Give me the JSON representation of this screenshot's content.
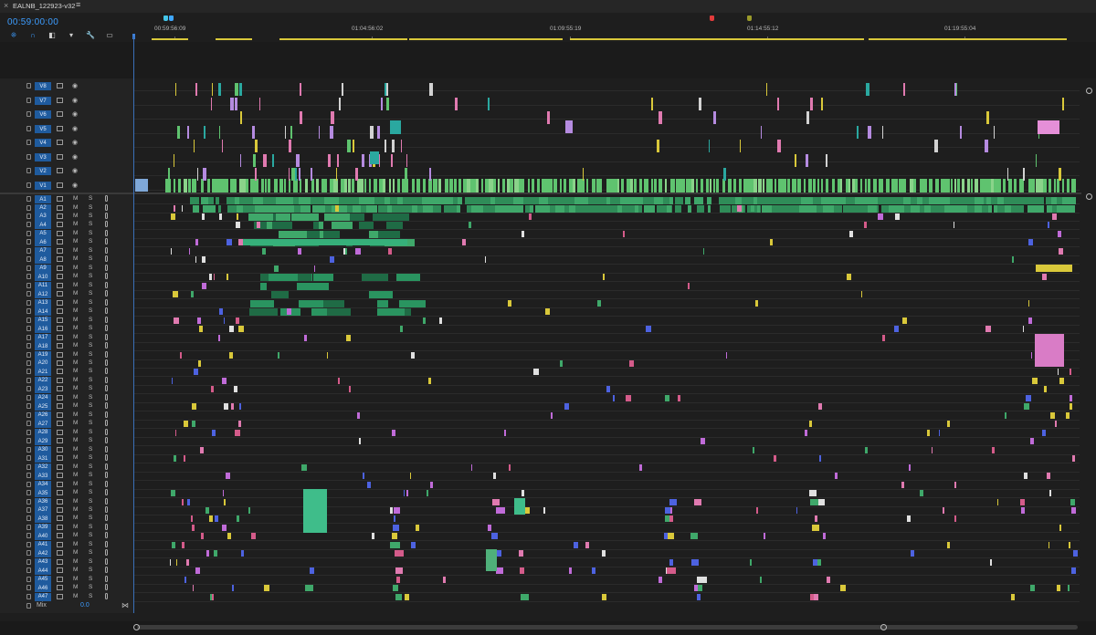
{
  "sequence": {
    "tab_title": "EALNB_122923-v32",
    "close_glyph": "×",
    "menu_glyph": "≡",
    "timecode": "00:59:00:00"
  },
  "toolbar": {
    "icons": [
      "snap-icon",
      "linked-selection-icon",
      "add-edit-icon",
      "add-marker-icon",
      "wrench-icon",
      "captions-icon"
    ],
    "glyphs": [
      "⁜",
      "∩",
      "◧",
      "▾",
      "🔧",
      "▭"
    ]
  },
  "ruler": {
    "ticks": [
      {
        "label": "00:59:56:09"
      },
      {
        "label": "01:04:56:02"
      },
      {
        "label": "01:09:55:19"
      },
      {
        "label": "01:14:55:12"
      },
      {
        "label": "01:19:55:04"
      }
    ],
    "markers": [
      {
        "color": "#44c6e8"
      },
      {
        "color": "#3fa7ff"
      },
      {
        "color": "#e23b3b"
      },
      {
        "color": "#9a9a2a"
      }
    ]
  },
  "video_tracks": [
    "V8",
    "V7",
    "V6",
    "V5",
    "V4",
    "V3",
    "V2",
    "V1"
  ],
  "audio_tracks": [
    "A1",
    "A2",
    "A3",
    "A4",
    "A5",
    "A6",
    "A7",
    "A8",
    "A9",
    "A10",
    "A11",
    "A12",
    "A13",
    "A14",
    "A15",
    "A16",
    "A17",
    "A18",
    "A19",
    "A20",
    "A21",
    "A22",
    "A23",
    "A24",
    "A25",
    "A26",
    "A27",
    "A28",
    "A29",
    "A30",
    "A31",
    "A32",
    "A33",
    "A34",
    "A35",
    "A36",
    "A37",
    "A38",
    "A39",
    "A40",
    "A41",
    "A42",
    "A43",
    "A44",
    "A45",
    "A46",
    "A47"
  ],
  "audio_buttons": {
    "mute": "M",
    "solo": "S"
  },
  "eye_glyph": "◉",
  "mix": {
    "label": "Mix",
    "value": "0.0",
    "end_glyph": "⋈"
  },
  "colors": {
    "accent_blue": "#3d9dff",
    "track_label_bg": "#1f5b9e",
    "audio_green": "#3fa86a",
    "video_green": "#5fc36f",
    "purple": "#b58be0",
    "pink": "#e07ab0",
    "teal": "#2aa8a0",
    "yellow": "#d9c83a",
    "dark_green": "#1f6b45",
    "blue": "#4d62e0"
  }
}
